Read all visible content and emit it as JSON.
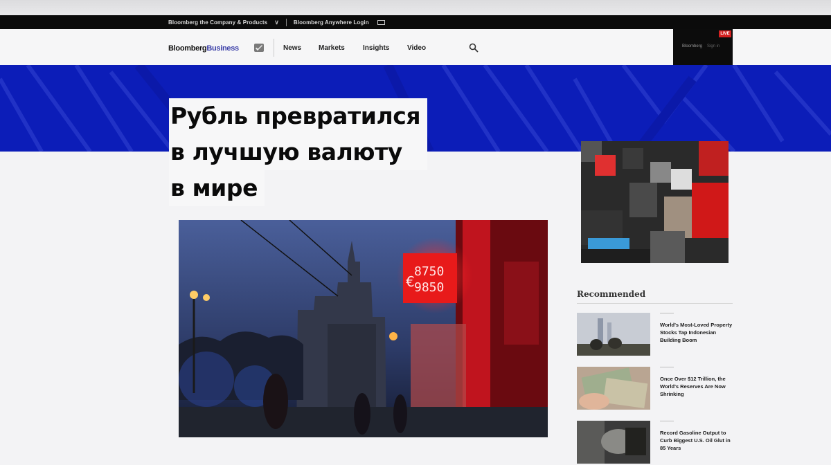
{
  "topbar": {
    "company_label": "Bloomberg the Company & Products",
    "chevron": "∨",
    "login_label": "Bloomberg Anywhere Login"
  },
  "nav": {
    "brand_part1": "Bloomberg",
    "brand_part2": "Business",
    "links": [
      "News",
      "Markets",
      "Insights",
      "Video"
    ],
    "right_label_1": "Bloomberg",
    "right_label_2": "Sign in",
    "live_badge": "LIVE"
  },
  "article": {
    "headline_lines": [
      "Рубль превратился",
      "в лучшую валюту",
      "в мире"
    ],
    "sign_line_1": "8750",
    "sign_line_2": "9850",
    "sign_currency": "€"
  },
  "recommended": {
    "title": "Recommended",
    "items": [
      {
        "text": "World's Most-Loved Property Stocks Tap Indonesian Building Boom"
      },
      {
        "text": "Once Over $12 Trillion, the World's Reserves Are Now Shrinking"
      },
      {
        "text": "Record Gasoline Output to Curb Biggest U.S. Oil Glut in 85 Years"
      }
    ]
  },
  "colors": {
    "band_blue": "#0c1db8",
    "brand_accent": "#3b3fa8",
    "sign_red": "#e81a1a"
  },
  "icons": [
    "mail-icon",
    "search-icon",
    "monitor-icon",
    "chevron-down-icon"
  ]
}
